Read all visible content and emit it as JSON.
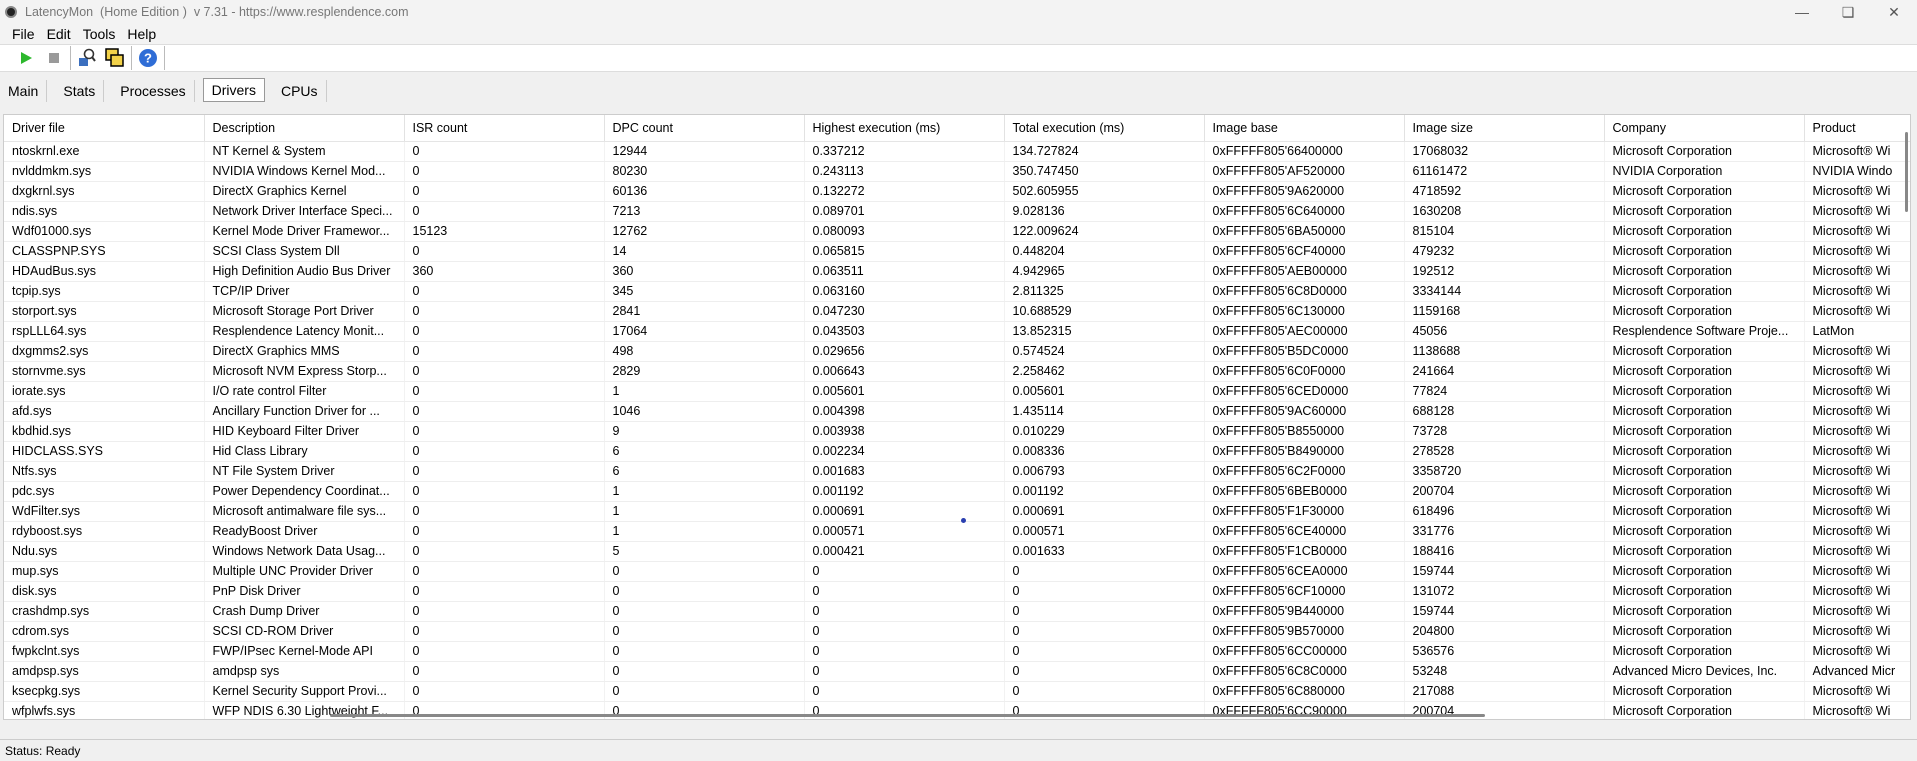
{
  "window": {
    "title": "LatencyMon  (Home Edition )  v 7.31 - https://www.resplendence.com"
  },
  "menu": [
    "File",
    "Edit",
    "Tools",
    "Help"
  ],
  "toolbar": {
    "icons": [
      "play-icon",
      "stop-icon",
      "scan-icon",
      "window-icon",
      "help-icon"
    ]
  },
  "tabs": [
    {
      "label": "Main",
      "active": false
    },
    {
      "label": "Stats",
      "active": false
    },
    {
      "label": "Processes",
      "active": false
    },
    {
      "label": "Drivers",
      "active": true
    },
    {
      "label": "CPUs",
      "active": false
    }
  ],
  "table": {
    "columns": [
      "Driver file",
      "Description",
      "ISR count",
      "DPC count",
      "Highest execution (ms)",
      "Total execution (ms)",
      "Image base",
      "Image size",
      "Company",
      "Product"
    ],
    "rows": [
      [
        "ntoskrnl.exe",
        "NT Kernel & System",
        "0",
        "12944",
        "0.337212",
        "134.727824",
        "0xFFFFF805'66400000",
        "17068032",
        "Microsoft Corporation",
        "Microsoft® Wi"
      ],
      [
        "nvlddmkm.sys",
        "NVIDIA Windows Kernel Mod...",
        "0",
        "80230",
        "0.243113",
        "350.747450",
        "0xFFFFF805'AF520000",
        "61161472",
        "NVIDIA Corporation",
        "NVIDIA Windo"
      ],
      [
        "dxgkrnl.sys",
        "DirectX Graphics Kernel",
        "0",
        "60136",
        "0.132272",
        "502.605955",
        "0xFFFFF805'9A620000",
        "4718592",
        "Microsoft Corporation",
        "Microsoft® Wi"
      ],
      [
        "ndis.sys",
        "Network Driver Interface Speci...",
        "0",
        "7213",
        "0.089701",
        "9.028136",
        "0xFFFFF805'6C640000",
        "1630208",
        "Microsoft Corporation",
        "Microsoft® Wi"
      ],
      [
        "Wdf01000.sys",
        "Kernel Mode Driver Framewor...",
        "15123",
        "12762",
        "0.080093",
        "122.009624",
        "0xFFFFF805'6BA50000",
        "815104",
        "Microsoft Corporation",
        "Microsoft® Wi"
      ],
      [
        "CLASSPNP.SYS",
        "SCSI Class System Dll",
        "0",
        "14",
        "0.065815",
        "0.448204",
        "0xFFFFF805'6CF40000",
        "479232",
        "Microsoft Corporation",
        "Microsoft® Wi"
      ],
      [
        "HDAudBus.sys",
        "High Definition Audio Bus Driver",
        "360",
        "360",
        "0.063511",
        "4.942965",
        "0xFFFFF805'AEB00000",
        "192512",
        "Microsoft Corporation",
        "Microsoft® Wi"
      ],
      [
        "tcpip.sys",
        "TCP/IP Driver",
        "0",
        "345",
        "0.063160",
        "2.811325",
        "0xFFFFF805'6C8D0000",
        "3334144",
        "Microsoft Corporation",
        "Microsoft® Wi"
      ],
      [
        "storport.sys",
        "Microsoft Storage Port Driver",
        "0",
        "2841",
        "0.047230",
        "10.688529",
        "0xFFFFF805'6C130000",
        "1159168",
        "Microsoft Corporation",
        "Microsoft® Wi"
      ],
      [
        "rspLLL64.sys",
        "Resplendence Latency Monit...",
        "0",
        "17064",
        "0.043503",
        "13.852315",
        "0xFFFFF805'AEC00000",
        "45056",
        "Resplendence Software Proje...",
        "LatMon"
      ],
      [
        "dxgmms2.sys",
        "DirectX Graphics MMS",
        "0",
        "498",
        "0.029656",
        "0.574524",
        "0xFFFFF805'B5DC0000",
        "1138688",
        "Microsoft Corporation",
        "Microsoft® Wi"
      ],
      [
        "stornvme.sys",
        "Microsoft NVM Express Storp...",
        "0",
        "2829",
        "0.006643",
        "2.258462",
        "0xFFFFF805'6C0F0000",
        "241664",
        "Microsoft Corporation",
        "Microsoft® Wi"
      ],
      [
        "iorate.sys",
        "I/O rate control Filter",
        "0",
        "1",
        "0.005601",
        "0.005601",
        "0xFFFFF805'6CED0000",
        "77824",
        "Microsoft Corporation",
        "Microsoft® Wi"
      ],
      [
        "afd.sys",
        "Ancillary Function Driver for ...",
        "0",
        "1046",
        "0.004398",
        "1.435114",
        "0xFFFFF805'9AC60000",
        "688128",
        "Microsoft Corporation",
        "Microsoft® Wi"
      ],
      [
        "kbdhid.sys",
        "HID Keyboard Filter Driver",
        "0",
        "9",
        "0.003938",
        "0.010229",
        "0xFFFFF805'B8550000",
        "73728",
        "Microsoft Corporation",
        "Microsoft® Wi"
      ],
      [
        "HIDCLASS.SYS",
        "Hid Class Library",
        "0",
        "6",
        "0.002234",
        "0.008336",
        "0xFFFFF805'B8490000",
        "278528",
        "Microsoft Corporation",
        "Microsoft® Wi"
      ],
      [
        "Ntfs.sys",
        "NT File System Driver",
        "0",
        "6",
        "0.001683",
        "0.006793",
        "0xFFFFF805'6C2F0000",
        "3358720",
        "Microsoft Corporation",
        "Microsoft® Wi"
      ],
      [
        "pdc.sys",
        "Power Dependency Coordinat...",
        "0",
        "1",
        "0.001192",
        "0.001192",
        "0xFFFFF805'6BEB0000",
        "200704",
        "Microsoft Corporation",
        "Microsoft® Wi"
      ],
      [
        "WdFilter.sys",
        "Microsoft antimalware file sys...",
        "0",
        "1",
        "0.000691",
        "0.000691",
        "0xFFFFF805'F1F30000",
        "618496",
        "Microsoft Corporation",
        "Microsoft® Wi"
      ],
      [
        "rdyboost.sys",
        "ReadyBoost Driver",
        "0",
        "1",
        "0.000571",
        "0.000571",
        "0xFFFFF805'6CE40000",
        "331776",
        "Microsoft Corporation",
        "Microsoft® Wi"
      ],
      [
        "Ndu.sys",
        "Windows Network Data Usag...",
        "0",
        "5",
        "0.000421",
        "0.001633",
        "0xFFFFF805'F1CB0000",
        "188416",
        "Microsoft Corporation",
        "Microsoft® Wi"
      ],
      [
        "mup.sys",
        "Multiple UNC Provider Driver",
        "0",
        "0",
        "0",
        "0",
        "0xFFFFF805'6CEA0000",
        "159744",
        "Microsoft Corporation",
        "Microsoft® Wi"
      ],
      [
        "disk.sys",
        "PnP Disk Driver",
        "0",
        "0",
        "0",
        "0",
        "0xFFFFF805'6CF10000",
        "131072",
        "Microsoft Corporation",
        "Microsoft® Wi"
      ],
      [
        "crashdmp.sys",
        "Crash Dump Driver",
        "0",
        "0",
        "0",
        "0",
        "0xFFFFF805'9B440000",
        "159744",
        "Microsoft Corporation",
        "Microsoft® Wi"
      ],
      [
        "cdrom.sys",
        "SCSI CD-ROM Driver",
        "0",
        "0",
        "0",
        "0",
        "0xFFFFF805'9B570000",
        "204800",
        "Microsoft Corporation",
        "Microsoft® Wi"
      ],
      [
        "fwpkclnt.sys",
        "FWP/IPsec Kernel-Mode API",
        "0",
        "0",
        "0",
        "0",
        "0xFFFFF805'6CC00000",
        "536576",
        "Microsoft Corporation",
        "Microsoft® Wi"
      ],
      [
        "amdpsp.sys",
        "amdpsp sys",
        "0",
        "0",
        "0",
        "0",
        "0xFFFFF805'6C8C0000",
        "53248",
        "Advanced Micro Devices, Inc.",
        "Advanced Micr"
      ],
      [
        "ksecpkg.sys",
        "Kernel Security Support Provi...",
        "0",
        "0",
        "0",
        "0",
        "0xFFFFF805'6C880000",
        "217088",
        "Microsoft Corporation",
        "Microsoft® Wi"
      ],
      [
        "wfplwfs.sys",
        "WFP NDIS 6.30 Lightweight F...",
        "0",
        "0",
        "0",
        "0",
        "0xFFFFF805'6CC90000",
        "200704",
        "Microsoft Corporation",
        "Microsoft® Wi"
      ]
    ]
  },
  "status": "Status: Ready"
}
